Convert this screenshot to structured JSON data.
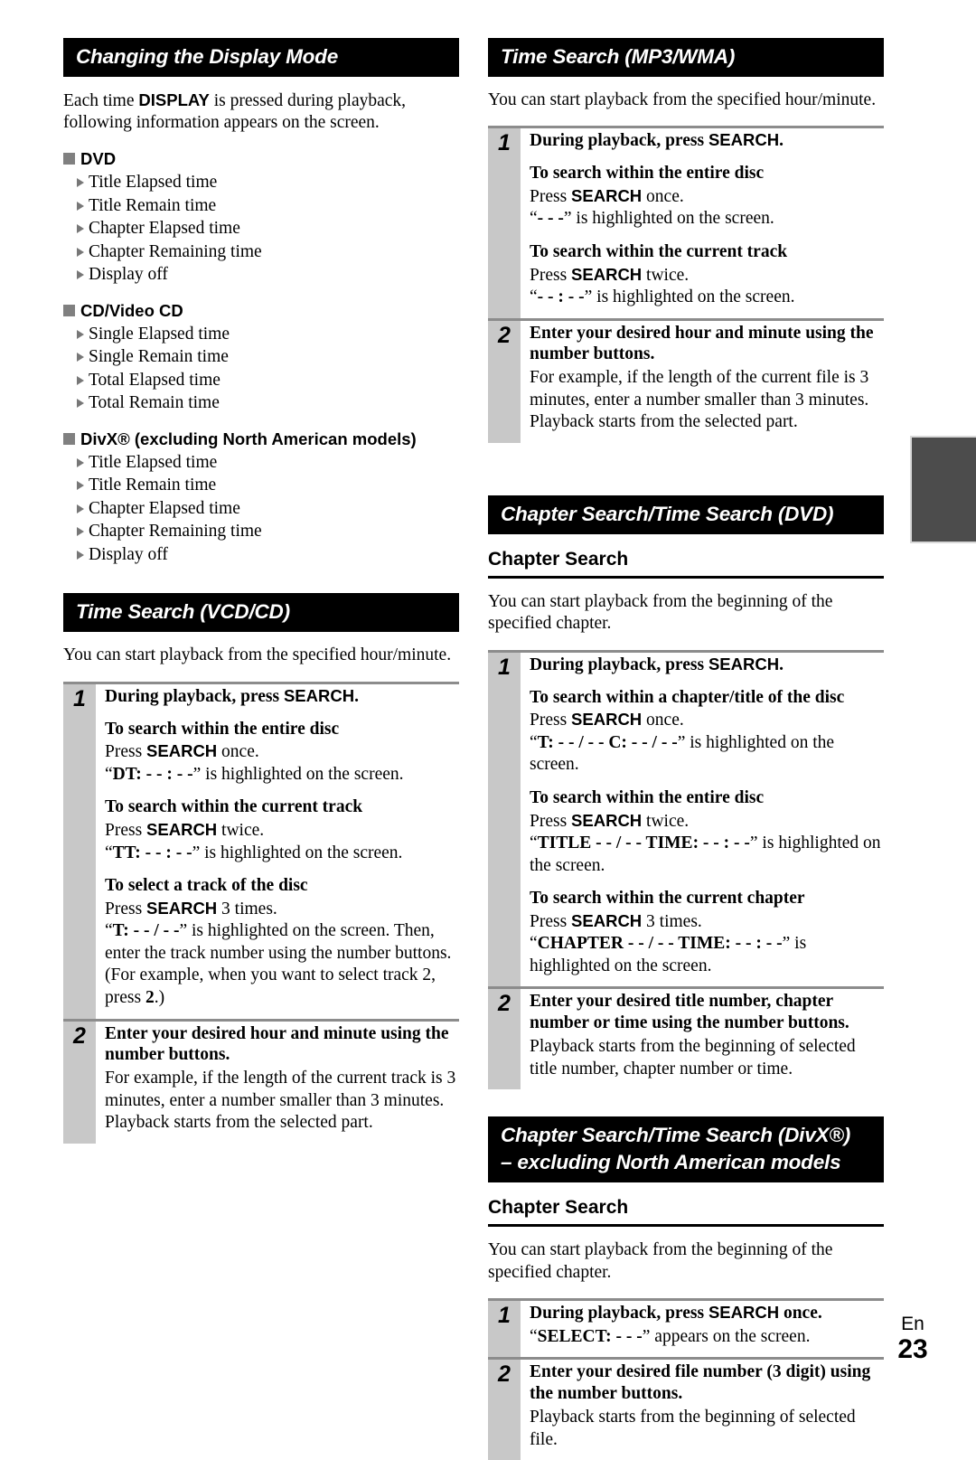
{
  "page": {
    "language_label": "En",
    "page_number": "23"
  },
  "left_column": {
    "section1": {
      "banner": "Changing the Display Mode",
      "intro_html": "Each time <b class=\"sans-b\">DISPLAY</b> is pressed during playback, following information appears on the screen.",
      "groups": [
        {
          "heading": "DVD",
          "items": [
            "Title Elapsed time",
            "Title Remain time",
            "Chapter Elapsed time",
            "Chapter Remaining time",
            "Display off"
          ]
        },
        {
          "heading": "CD/Video CD",
          "items": [
            "Single Elapsed time",
            "Single Remain time",
            "Total Elapsed time",
            "Total Remain time"
          ]
        },
        {
          "heading": "DivX® (excluding North American models)",
          "items": [
            "Title Elapsed time",
            "Title Remain time",
            "Chapter Elapsed time",
            "Chapter Remaining time",
            "Display off"
          ]
        }
      ]
    },
    "section2": {
      "banner": "Time Search (VCD/CD)",
      "intro": "You can start playback from the specified hour/minute.",
      "steps": [
        {
          "num": "1",
          "title_html": "During playback, press <b class=\"sans-b\">SEARCH</b>.",
          "blocks": [
            {
              "sub": "To search within the entire disc",
              "lines_html": [
                "Press <b class=\"sans-b\">SEARCH</b> once.",
                "“<b>DT: - - : - -</b>” is highlighted on the screen."
              ]
            },
            {
              "sub": "To search within the current track",
              "lines_html": [
                "Press <b class=\"sans-b\">SEARCH</b> twice.",
                "“<b>TT: - - : - -</b>” is highlighted on the screen."
              ]
            },
            {
              "sub": "To select a track of the disc",
              "lines_html": [
                "Press <b class=\"sans-b\">SEARCH</b> 3 times.",
                "“<b>T: - - / - -</b>” is highlighted on the screen. Then, enter the track number using the number buttons. (For example, when you want to select track 2, press <b>2</b>.)"
              ]
            }
          ]
        },
        {
          "num": "2",
          "title_html": "Enter your desired hour and minute using the number buttons.",
          "blocks": [
            {
              "sub": "",
              "lines_html": [
                "For example, if the length of the current track is 3 minutes, enter a number smaller than 3 minutes.",
                "Playback starts from the selected part."
              ]
            }
          ]
        }
      ]
    }
  },
  "right_column": {
    "section1": {
      "banner": "Time Search (MP3/WMA)",
      "intro": "You can start playback from the specified hour/minute.",
      "steps": [
        {
          "num": "1",
          "title_html": "During playback, press <b class=\"sans-b\">SEARCH</b>.",
          "blocks": [
            {
              "sub": "To search within the entire disc",
              "lines_html": [
                "Press <b class=\"sans-b\">SEARCH</b> once.",
                "“<b>- - -</b>” is highlighted on the screen."
              ]
            },
            {
              "sub": "To search within the current track",
              "lines_html": [
                "Press <b class=\"sans-b\">SEARCH</b> twice.",
                "“<b>- - : - -</b>” is highlighted on the screen."
              ]
            }
          ]
        },
        {
          "num": "2",
          "title_html": "Enter your desired hour and minute using the number buttons.",
          "blocks": [
            {
              "sub": "",
              "lines_html": [
                "For example, if the length of the current file is 3 minutes, enter a number smaller than 3 minutes.",
                "Playback starts from the selected part."
              ]
            }
          ]
        }
      ]
    },
    "section2": {
      "banner": "Chapter Search/Time Search (DVD)",
      "subheading": "Chapter Search",
      "intro": "You can start playback from the beginning of the specified chapter.",
      "steps": [
        {
          "num": "1",
          "title_html": "During playback, press <b class=\"sans-b\">SEARCH</b>.",
          "blocks": [
            {
              "sub": "To search within a chapter/title of the disc",
              "lines_html": [
                "Press <b class=\"sans-b\">SEARCH</b> once.",
                "“<b>T: - - / - - C: - - / - -</b>” is highlighted on the screen."
              ]
            },
            {
              "sub": "To search within the entire disc",
              "lines_html": [
                "Press <b class=\"sans-b\">SEARCH</b> twice.",
                "“<b>TITLE - - / - - TIME: - - : - -</b>” is highlighted on the screen."
              ]
            },
            {
              "sub": "To search within the current chapter",
              "lines_html": [
                "Press <b class=\"sans-b\">SEARCH</b> 3 times.",
                "“<b>CHAPTER - - / - - TIME: - - : - -</b>” is highlighted on the screen."
              ]
            }
          ]
        },
        {
          "num": "2",
          "title_html": "Enter your desired title number, chapter number or time using the number buttons.",
          "blocks": [
            {
              "sub": "",
              "lines_html": [
                "Playback starts from the beginning of selected title number, chapter number or time."
              ]
            }
          ]
        }
      ]
    },
    "section3": {
      "banner_line1": "Chapter Search/Time Search (DivX®)",
      "banner_line2": "– excluding North American models",
      "subheading": "Chapter Search",
      "intro": "You can start playback from the beginning of the specified chapter.",
      "steps": [
        {
          "num": "1",
          "title_html": "During playback, press <b class=\"sans-b\">SEARCH</b> once.",
          "blocks": [
            {
              "sub": "",
              "lines_html": [
                "“<b>SELECT: - - -</b>” appears on the screen."
              ]
            }
          ]
        },
        {
          "num": "2",
          "title_html": "Enter your desired file number (3 digit) using the number buttons.",
          "blocks": [
            {
              "sub": "",
              "lines_html": [
                "Playback starts from the beginning of selected file."
              ]
            }
          ]
        }
      ]
    }
  }
}
